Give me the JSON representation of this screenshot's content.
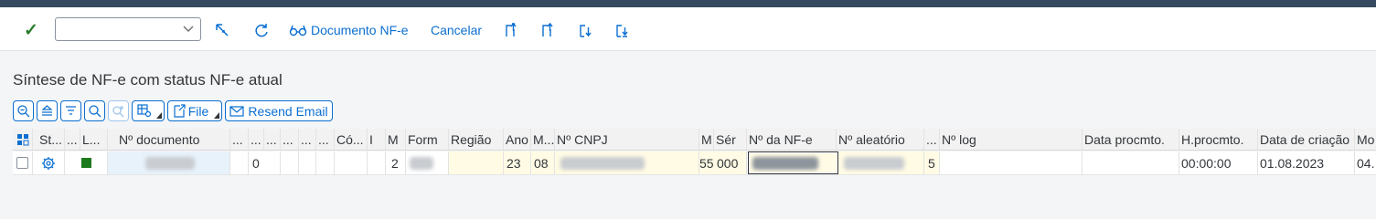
{
  "toolbar": {
    "check_icon": "checkmark-icon",
    "dropdown_value": "",
    "document_btn_label": "Documento NF-e",
    "cancel_btn_label": "Cancelar"
  },
  "page": {
    "title": "Síntese de NF-e com status NF-e atual"
  },
  "alv_toolbar": {
    "file_label": "File",
    "resend_label": "Resend Email"
  },
  "table": {
    "headers": {
      "status": "St...",
      "dots1": "...",
      "l": "L...",
      "doc_number": "Nº documento",
      "d1": "...",
      "d2": "...",
      "d3": "...",
      "d4": "...",
      "d5": "...",
      "d6": "...",
      "co": "Có...",
      "i": "I",
      "m": "M",
      "form": "Form",
      "region": "Região",
      "year": "Ano",
      "month": "M...",
      "cnpj": "Nº CNPJ",
      "m2": "M",
      "series": "Sér",
      "nfe_number": "Nº da NF-e",
      "random": "Nº aleatório",
      "d7": "...",
      "log": "Nº log",
      "proc_date": "Data procmto.",
      "proc_time": "H.procmto.",
      "created": "Data de criação",
      "mod": "Mo"
    },
    "row": {
      "zero": "0",
      "m": "2",
      "year": "23",
      "month": "08",
      "model": "55",
      "series": "000",
      "log_digit": "5",
      "proc_time": "00:00:00",
      "created": "01.08.2023",
      "mod": "04."
    }
  }
}
